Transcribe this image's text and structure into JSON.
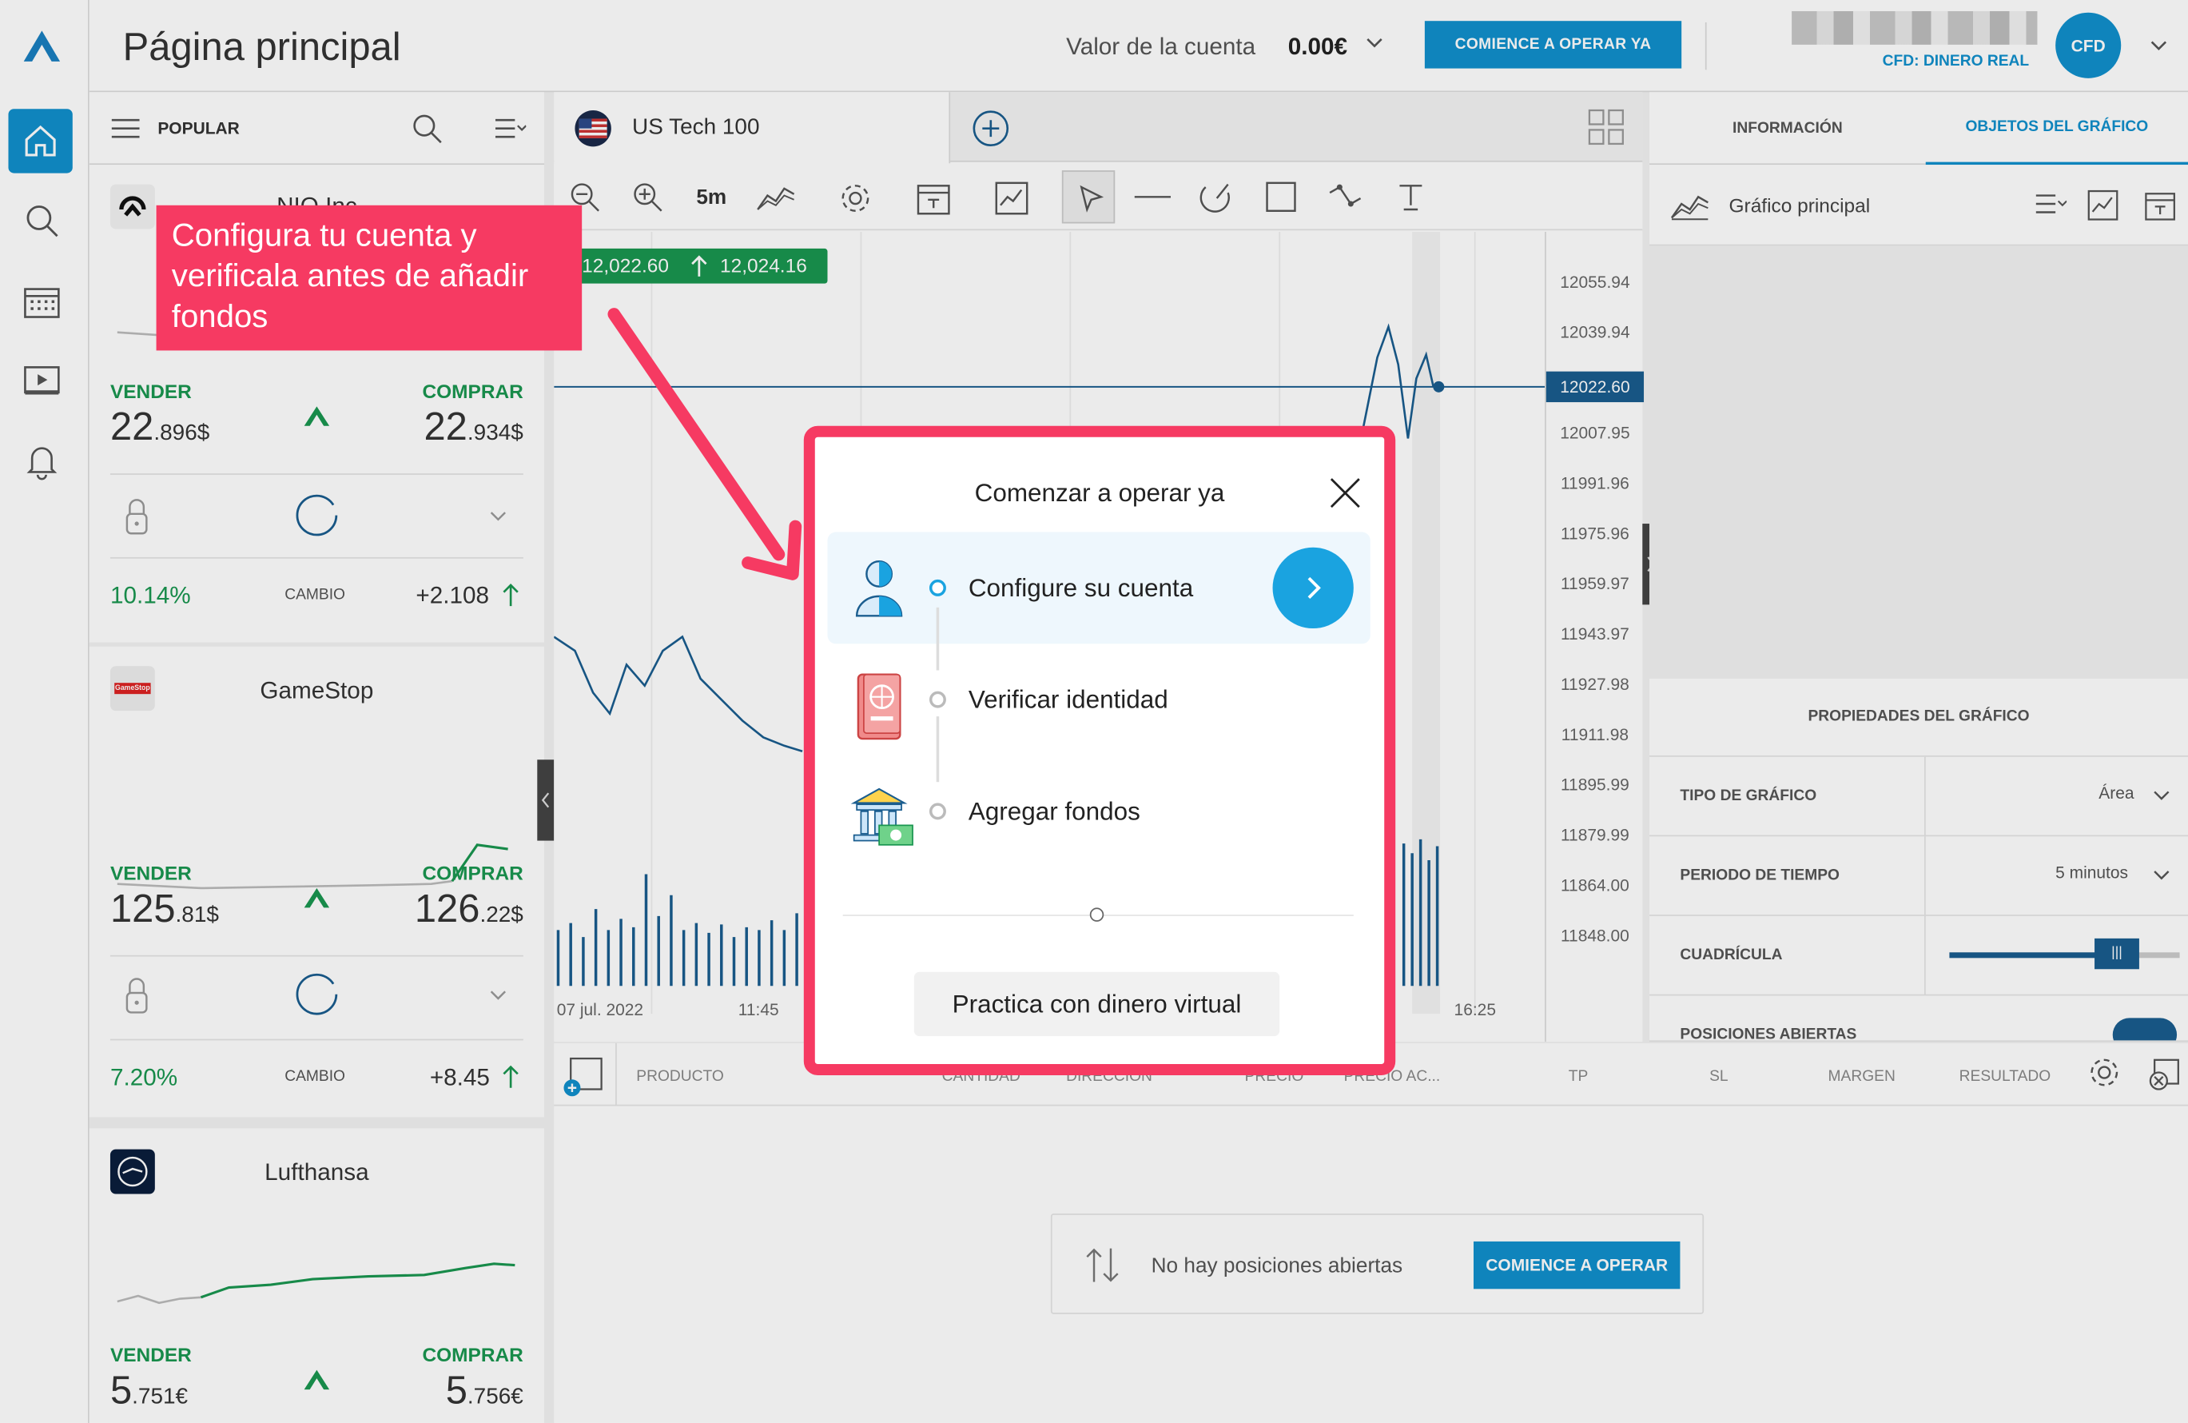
{
  "header": {
    "title": "Página principal",
    "account_label": "Valor de la cuenta",
    "account_value": "0.00€",
    "trade_button": "COMIENCE A OPERAR YA",
    "account_mode": "CFD: DINERO REAL",
    "avatar": "CFD"
  },
  "watchlist": {
    "title": "POPULAR",
    "cards": [
      {
        "name": "NIO Inc",
        "sell_label": "VENDER",
        "buy_label": "COMPRAR",
        "sell_big": "22",
        "sell_small": ".896$",
        "buy_big": "22",
        "buy_small": ".934$",
        "change_pct": "10.14%",
        "change_label": "CAMBIO",
        "change_val": "+2.108"
      },
      {
        "name": "GameStop",
        "logo_text": "GameStop",
        "sell_label": "VENDER",
        "buy_label": "COMPRAR",
        "sell_big": "125",
        "sell_small": ".81$",
        "buy_big": "126",
        "buy_small": ".22$",
        "change_pct": "7.20%",
        "change_label": "CAMBIO",
        "change_val": "+8.45"
      },
      {
        "name": "Lufthansa",
        "sell_label": "VENDER",
        "buy_label": "COMPRAR",
        "sell_big": "5",
        "sell_small": ".751€",
        "buy_big": "5",
        "buy_small": ".756€"
      }
    ]
  },
  "chart": {
    "instrument": "US Tech 100",
    "timeframe": "5m",
    "price_low": "12,022.60",
    "price_high": "12,024.16",
    "y_ticks": [
      "12055.94",
      "12039.94",
      "12022.60",
      "12007.95",
      "11991.96",
      "11975.96",
      "11959.97",
      "11943.97",
      "11927.98",
      "11911.98",
      "11895.99",
      "11879.99",
      "11864.00",
      "11848.00"
    ],
    "x_ticks": [
      "07 jul. 2022",
      "11:45",
      "16:25"
    ]
  },
  "right_panel": {
    "tab_info": "INFORMACIÓN",
    "tab_objects": "OBJETOS DEL GRÁFICO",
    "main_chart": "Gráfico principal",
    "props_title": "PROPIEDADES DEL GRÁFICO",
    "chart_type_label": "TIPO DE GRÁFICO",
    "chart_type_value": "Área",
    "period_label": "PERIODO DE TIEMPO",
    "period_value": "5 minutos",
    "grid_label": "CUADRÍCULA",
    "open_positions_label": "POSICIONES ABIERTAS"
  },
  "positions": {
    "columns": [
      "PRODUCTO",
      "CANTIDAD",
      "DIRECCIÓN",
      "PRECIO",
      "PRECIO AC...",
      "TP",
      "SL",
      "MARGEN",
      "RESULTADO"
    ],
    "empty_text": "No hay posiciones abiertas",
    "start_button": "COMIENCE A OPERAR"
  },
  "callout": {
    "text": "Configura tu cuenta y verificala antes de añadir fondos"
  },
  "modal": {
    "title": "Comenzar a operar ya",
    "steps": [
      "Configure su cuenta",
      "Verificar identidad",
      "Agregar fondos"
    ],
    "demo_button": "Practica con dinero virtual"
  },
  "colors": {
    "accent": "#1190cc",
    "callout": "#f63a62",
    "positive": "#1a9650"
  }
}
